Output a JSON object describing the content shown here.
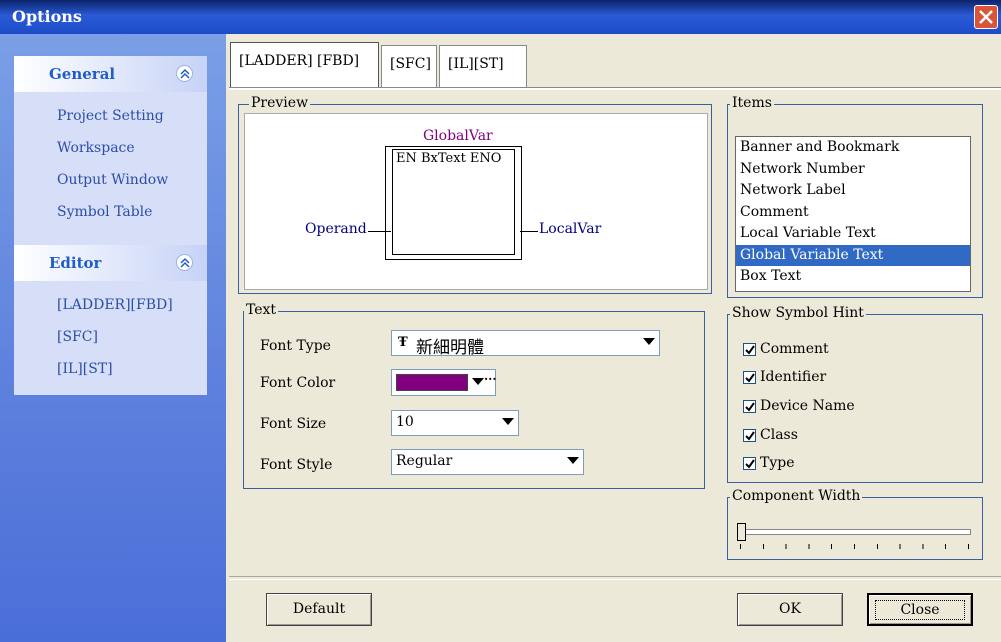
{
  "window": {
    "title": "Options"
  },
  "sidebar": {
    "groups": [
      {
        "label": "General",
        "items": [
          "Project Setting",
          "Workspace",
          "Output Window",
          "Symbol Table"
        ]
      },
      {
        "label": "Editor",
        "items": [
          "[LADDER][FBD]",
          "[SFC]",
          "[IL][ST]"
        ]
      }
    ]
  },
  "tabs": [
    "[LADDER] [FBD]",
    "[SFC]",
    "[IL][ST]"
  ],
  "preview": {
    "title": "Preview",
    "global_var": "GlobalVar",
    "box_text": "EN BxText ENO",
    "operand": "Operand",
    "local_var": "LocalVar"
  },
  "text_panel": {
    "title": "Text",
    "font_type_label": "Font Type",
    "font_type_value": "新細明體",
    "font_type_icon": "truetype-icon",
    "font_color_label": "Font Color",
    "font_color_value": "#800080",
    "font_size_label": "Font Size",
    "font_size_value": "10",
    "font_style_label": "Font Style",
    "font_style_value": "Regular",
    "more_button": "···"
  },
  "items_panel": {
    "title": "Items",
    "items": [
      "Banner and Bookmark",
      "Network Number",
      "Network Label",
      "Comment",
      "Local Variable Text",
      "Global Variable Text",
      "Box Text"
    ],
    "selected": "Global Variable Text"
  },
  "symbol_hint": {
    "title": "Show Symbol Hint",
    "options": [
      {
        "label": "Comment",
        "checked": true
      },
      {
        "label": "Identifier",
        "checked": true
      },
      {
        "label": "Device Name",
        "checked": true
      },
      {
        "label": "Class",
        "checked": true
      },
      {
        "label": "Type",
        "checked": true
      }
    ]
  },
  "component_width": {
    "title": "Component Width",
    "value": 0
  },
  "buttons": {
    "default": "Default",
    "ok": "OK",
    "close": "Close"
  },
  "colors": {
    "accent": "#316ac5",
    "font_color": "#800080",
    "global_var_text": "#800080"
  }
}
